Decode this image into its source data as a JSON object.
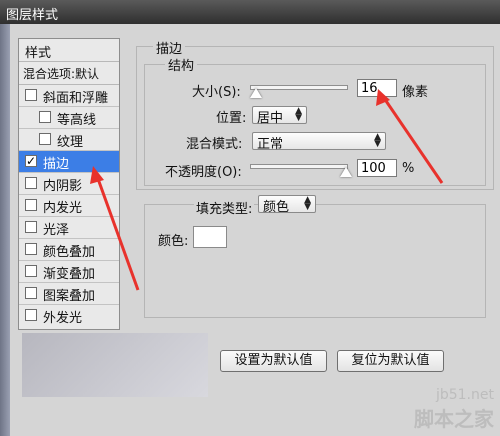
{
  "window": {
    "title": "图层样式"
  },
  "styles_panel": {
    "header": "样式",
    "blend_options": "混合选项:默认",
    "items": [
      {
        "label": "斜面和浮雕",
        "checked": false
      },
      {
        "label": "等高线",
        "checked": false
      },
      {
        "label": "纹理",
        "checked": false
      },
      {
        "label": "描边",
        "checked": true
      },
      {
        "label": "内阴影",
        "checked": false
      },
      {
        "label": "内发光",
        "checked": false
      },
      {
        "label": "光泽",
        "checked": false
      },
      {
        "label": "颜色叠加",
        "checked": false
      },
      {
        "label": "渐变叠加",
        "checked": false
      },
      {
        "label": "图案叠加",
        "checked": false
      },
      {
        "label": "外发光",
        "checked": false
      }
    ],
    "check_mark": "✓"
  },
  "stroke_panel": {
    "title": "描边",
    "structure_title": "结构",
    "size": {
      "label": "大小(S):",
      "value": "16",
      "unit": "像素",
      "slider_fraction": 0.06
    },
    "position": {
      "label": "位置:",
      "value": "居中"
    },
    "blend_mode": {
      "label": "混合模式:",
      "value": "正常"
    },
    "opacity": {
      "label": "不透明度(O):",
      "value": "100",
      "unit": "%",
      "slider_fraction": 1.0
    },
    "fill_type": {
      "label": "填充类型:",
      "value": "颜色"
    },
    "color": {
      "label": "颜色:",
      "swatch": "#ffffff"
    }
  },
  "buttons": {
    "set_default": "设置为默认值",
    "reset_default": "复位为默认值"
  },
  "watermark": {
    "url": "jb51.net",
    "name": "脚本之家"
  },
  "colors": {
    "selected_row": "#3c7ee6",
    "annotation_arrow": "#e8322c"
  }
}
